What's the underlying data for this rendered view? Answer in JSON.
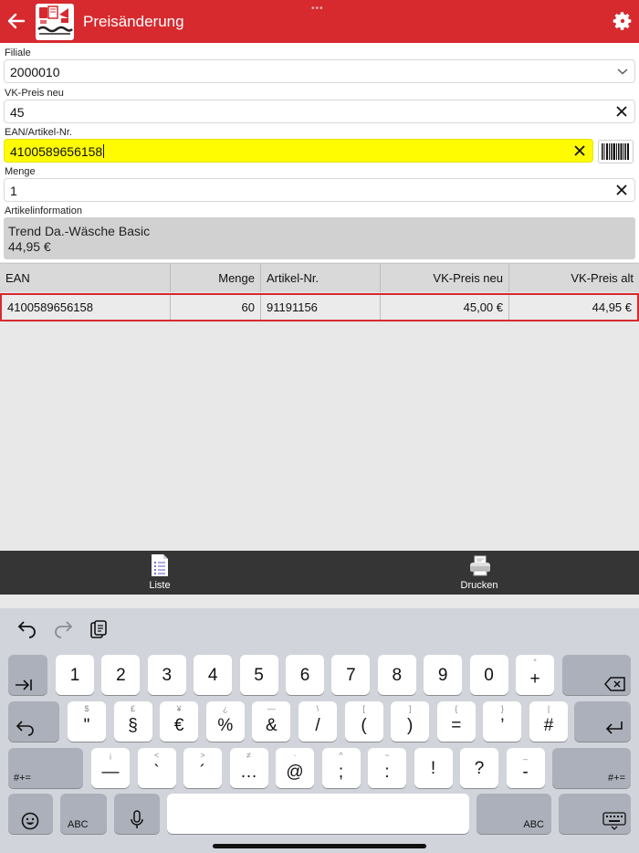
{
  "header": {
    "title": "Preisänderung",
    "accent_color": "#d62a2f"
  },
  "form": {
    "filiale": {
      "label": "Filiale",
      "value": "2000010"
    },
    "vk_preis": {
      "label": "VK-Preis neu",
      "value": "45"
    },
    "ean": {
      "label": "EAN/Artikel-Nr.",
      "value": "4100589656158",
      "highlight_color": "#fffb00"
    },
    "menge": {
      "label": "Menge",
      "value": "1"
    },
    "artikelinfo": {
      "label": "Artikelinformation",
      "name": "Trend Da.-Wäsche Basic",
      "price": "44,95 €"
    }
  },
  "table": {
    "headers": [
      "EAN",
      "Menge",
      "Artikel-Nr.",
      "VK-Preis neu",
      "VK-Preis alt"
    ],
    "rows": [
      [
        "4100589656158",
        "60",
        "91191156",
        "45,00 €",
        "44,95 €"
      ]
    ]
  },
  "toolbar": {
    "liste_label": "Liste",
    "drucken_label": "Drucken"
  },
  "keyboard": {
    "row1": [
      {
        "main": "1",
        "sub": ""
      },
      {
        "main": "2",
        "sub": ""
      },
      {
        "main": "3",
        "sub": ""
      },
      {
        "main": "4",
        "sub": ""
      },
      {
        "main": "5",
        "sub": ""
      },
      {
        "main": "6",
        "sub": ""
      },
      {
        "main": "7",
        "sub": ""
      },
      {
        "main": "8",
        "sub": ""
      },
      {
        "main": "9",
        "sub": ""
      },
      {
        "main": "0",
        "sub": ""
      },
      {
        "main": "+",
        "sub": "°"
      }
    ],
    "row2": [
      {
        "main": "\"",
        "sub": "$"
      },
      {
        "main": "§",
        "sub": "£"
      },
      {
        "main": "€",
        "sub": "¥"
      },
      {
        "main": "%",
        "sub": "¿"
      },
      {
        "main": "&",
        "sub": "—"
      },
      {
        "main": "/",
        "sub": "\\"
      },
      {
        "main": "(",
        "sub": "["
      },
      {
        "main": ")",
        "sub": "]"
      },
      {
        "main": "=",
        "sub": "{"
      },
      {
        "main": "’",
        "sub": "}"
      },
      {
        "main": "#",
        "sub": "|"
      }
    ],
    "row3": [
      {
        "main": "—",
        "sub": "¡"
      },
      {
        "main": "`",
        "sub": "<"
      },
      {
        "main": "´",
        "sub": ">"
      },
      {
        "main": "…",
        "sub": "≠"
      },
      {
        "main": "@",
        "sub": "·"
      },
      {
        "main": ";",
        "sub": "^"
      },
      {
        "main": ":",
        "sub": "~"
      },
      {
        "main": "!",
        "sub": ""
      },
      {
        "main": "?",
        "sub": ""
      },
      {
        "main": "-",
        "sub": "_"
      }
    ],
    "row3_extra": [
      ",",
      "."
    ],
    "shift_label": "#+=",
    "abc_label": "ABC"
  }
}
